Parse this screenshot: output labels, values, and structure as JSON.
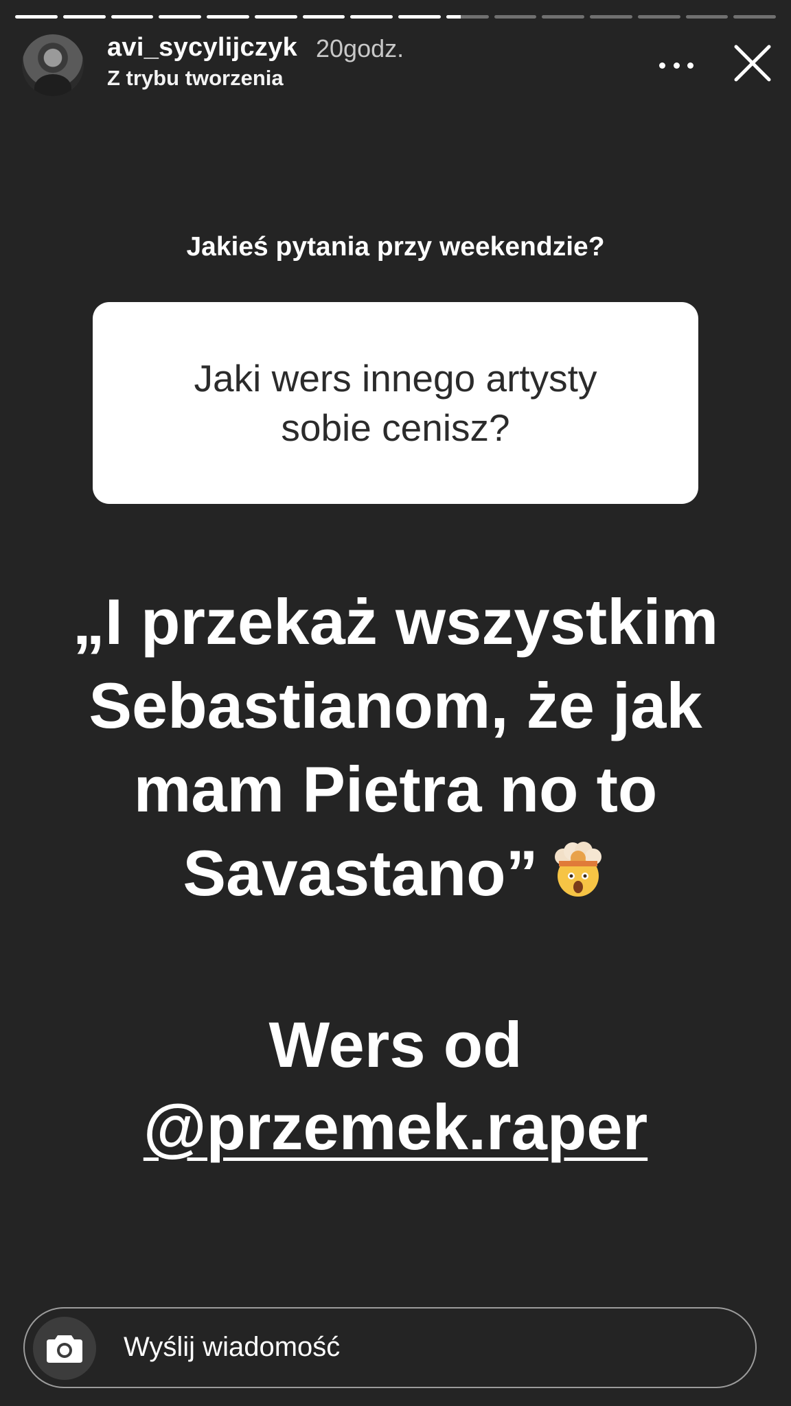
{
  "progress": {
    "segments": [
      1,
      1,
      1,
      1,
      1,
      1,
      1,
      1,
      1,
      0.35,
      0,
      0,
      0,
      0,
      0,
      0
    ]
  },
  "header": {
    "username": "avi_sycylijczyk",
    "time": "20godz.",
    "subtitle": "Z trybu tworzenia",
    "avatar_icon": "profile-photo",
    "more_icon": "more-horizontal-icon",
    "close_icon": "close-icon"
  },
  "question": {
    "prompt": "Jakieś pytania przy weekendzie?",
    "text": "Jaki wers innego artysty sobie cenisz?"
  },
  "quote": {
    "text": "„I przekaż wszystkim Sebastianom, że jak mam Pietra no to Savastano”",
    "emoji": "exploding-head-emoji"
  },
  "credit": {
    "line": "Wers od",
    "mention": "@przemek.raper"
  },
  "reply": {
    "placeholder": "Wyślij wiadomość",
    "camera_icon": "camera-icon"
  },
  "colors": {
    "background": "#242424",
    "card": "#ffffff",
    "card_text": "#2b2b2b"
  }
}
